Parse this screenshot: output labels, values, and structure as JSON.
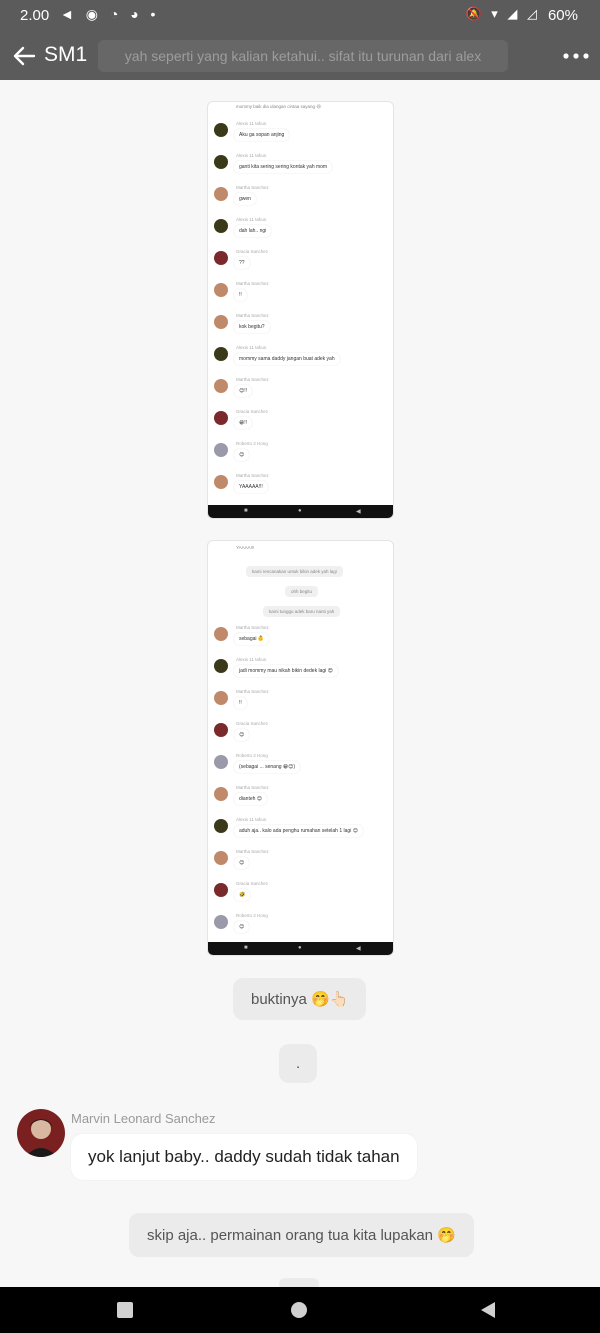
{
  "status": {
    "time": "2.00",
    "left_icons": "◄ ◉ ◔ ◕ •",
    "right_icons": "🔕 ▾ ◢ ◿",
    "battery": "60%"
  },
  "appbar": {
    "title": "SM1",
    "pinned": "yah seperti yang kalian ketahui.. sifat itu turunan dari alex"
  },
  "shot1": {
    "top_text": "mommy baik dia ulangan cintaa sayang 😆",
    "messages": [
      {
        "name": "Alexis 11 tahun",
        "text": "Aku ga sopan anjing",
        "avatar": "#3a3a1a"
      },
      {
        "name": "Alexis 11 tahun",
        "text": "ganti kita sering sering kontak yah mom",
        "avatar": "#3a3a1a"
      },
      {
        "name": "Martha Sanchez",
        "text": "gwen",
        "avatar": "#c08a6a"
      },
      {
        "name": "Alexis 11 tahun",
        "text": "dah lah.. ngi",
        "avatar": "#3a3a1a"
      },
      {
        "name": "Gracia Sanchez",
        "text": "??",
        "avatar": "#7a2a2a"
      },
      {
        "name": "Martha Sanchez",
        "text": "!!",
        "avatar": "#c08a6a"
      },
      {
        "name": "Martha Sanchez",
        "text": "kok begitu?",
        "avatar": "#c08a6a"
      },
      {
        "name": "Alexis 11 tahun",
        "text": "mommy sama daddy jangan buat adek yah",
        "avatar": "#3a3a1a"
      },
      {
        "name": "Martha Sanchez",
        "text": "😊!!",
        "avatar": "#c08a6a"
      },
      {
        "name": "Gracia Sanchez",
        "text": "😁!!",
        "avatar": "#7a2a2a"
      },
      {
        "name": "Roberto 2 Hong",
        "text": "😊",
        "avatar": "#9a9aaa"
      },
      {
        "name": "Martha Sanchez",
        "text": "YAAAAA!!!",
        "avatar": "#c08a6a"
      }
    ]
  },
  "shot2": {
    "top_text": "YAAAA!!!",
    "system": [
      "kami rencanakan untuk bikin adek yah lagi",
      "ohh begitu",
      "kami tunggu adek baru nanti yah"
    ],
    "messages": [
      {
        "name": "Martha Sanchez",
        "text": "sebagai 👶",
        "avatar": "#c08a6a"
      },
      {
        "name": "Alexis 11 tahun",
        "text": "jadi mommy mau nikah bikin dedek lagi 😍",
        "avatar": "#3a3a1a"
      },
      {
        "name": "Martha Sanchez",
        "text": "!!",
        "avatar": "#c08a6a"
      },
      {
        "name": "Gracia Sanchez",
        "text": "😊",
        "avatar": "#7a2a2a"
      },
      {
        "name": "Roberto 2 Hong",
        "text": "(sebagai ... senang 😁😊)",
        "avatar": "#9a9aaa"
      },
      {
        "name": "Martha Sanchez",
        "text": "dianteh 😊",
        "avatar": "#c08a6a"
      },
      {
        "name": "Alexis 11 tahun",
        "text": "aduh aja.. kalo ada penghu rumahan setelah 1 lagi 😊",
        "avatar": "#3a3a1a"
      },
      {
        "name": "Martha Sanchez",
        "text": "😊",
        "avatar": "#c08a6a"
      },
      {
        "name": "Gracia Sanchez",
        "text": "🤣",
        "avatar": "#7a2a2a"
      },
      {
        "name": "Roberto 2 Hong",
        "text": "😊",
        "avatar": "#9a9aaa"
      }
    ]
  },
  "chips": {
    "buktinya": "buktinya 🤭👆🏻",
    "dot": ".",
    "skip": "skip aja.. permainan orang tua kita lupakan 🤭"
  },
  "sender": {
    "name": "Marvin Leonard Sanchez",
    "text": "yok lanjut baby.. daddy sudah tidak tahan"
  },
  "colors": {
    "appbar": "#5b5b5b",
    "background": "#f7f7f7",
    "chip": "#ebebeb"
  }
}
